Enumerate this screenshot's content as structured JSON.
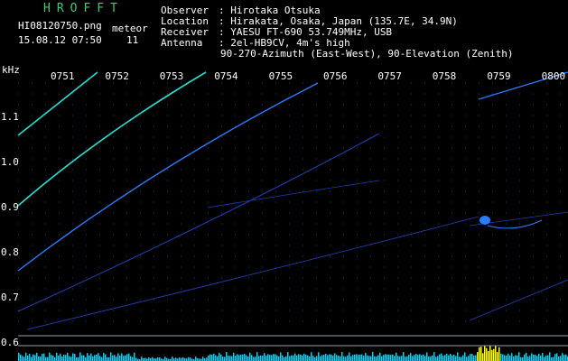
{
  "header": {
    "app_title": "HROFFT",
    "file_name": "HI08120750.png",
    "meteor_label": "meteor",
    "timestamp": "15.08.12 07:50",
    "meteor_count": "11"
  },
  "station": {
    "observer_label": "Observer",
    "observer": "Hirotaka Otsuka",
    "location_label": "Location",
    "location": "Hirakata, Osaka, Japan (135.7E, 34.9N)",
    "receiver_label": "Receiver",
    "receiver": "YAESU FT-690 53.749MHz, USB",
    "antenna_label": "Antenna",
    "antenna_line1": "2el-HB9CV, 4m's high",
    "antenna_line2": "90-270-Azimuth (East-West), 90-Elevation (Zenith)"
  },
  "spectrogram": {
    "y_unit": "kHz",
    "y_ticks": [
      "1.1",
      "1.0",
      "0.9",
      "0.8",
      "0.7",
      "0.6"
    ],
    "x_ticks": [
      "0751",
      "0752",
      "0753",
      "0754",
      "0755",
      "0756",
      "0757",
      "0758",
      "0759",
      "0800"
    ],
    "colors": {
      "background": "#000000",
      "trace_bright": "#22e0d0",
      "trace_mid": "#2a7cff",
      "trace_dim": "#1c3fb0",
      "grid_dot": "#1a3a9a",
      "baseline": "#9aa0a6",
      "level_bar": "#19c9f0",
      "level_peak": "#ffff00"
    }
  }
}
